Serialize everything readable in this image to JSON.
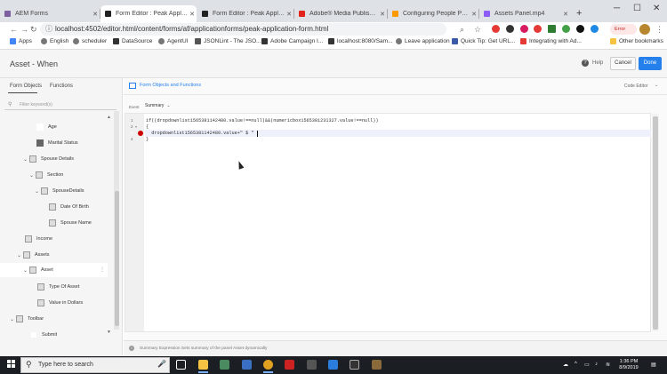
{
  "tabs": [
    {
      "title": "AEM Forms",
      "fav": "#7d5fa0"
    },
    {
      "title": "Form Editor : Peak Applicatio",
      "fav": "#222222"
    },
    {
      "title": "Form Editor : Peak Applicatio",
      "fav": "#222222"
    },
    {
      "title": "Adobe® Media Publishing",
      "fav": "#e1251b"
    },
    {
      "title": "Configuring People Panel in",
      "fav": "#ff9a00"
    },
    {
      "title": "Assets Panel.mp4",
      "fav": "#8e5cf7"
    }
  ],
  "window": {
    "minimize": "─",
    "maximize": "☐",
    "close": "✕",
    "new_tab": "+"
  },
  "url": "localhost:4502/editor.html/content/forms/af/applicationforms/peak-application-form.html",
  "bookmarks": [
    "Apps",
    "English",
    "scheduler",
    "DataSource",
    "AgentUI",
    "JSONLint - The JSO...",
    "Adobe Campaign I...",
    "localhost:8080/Sam...",
    "Leave application",
    "Quick Tip: Get URL...",
    "Integrating with Ad..."
  ],
  "other_bookmarks": "Other bookmarks",
  "profile_label": "Error",
  "header": {
    "title": "Asset - When",
    "help": "Help",
    "cancel": "Cancel",
    "done": "Done"
  },
  "left_tabs": [
    "Form Objects",
    "Functions"
  ],
  "filter_placeholder": "Filter keyword(s)",
  "tree": [
    {
      "label": "Age"
    },
    {
      "label": "Marital Status"
    },
    {
      "label": "Spouse Details"
    },
    {
      "label": "Section"
    },
    {
      "label": "SpouseDetails"
    },
    {
      "label": "Date Of Birth"
    },
    {
      "label": "Spouse Name"
    },
    {
      "label": "Income"
    },
    {
      "label": "Assets"
    },
    {
      "label": "Asset"
    },
    {
      "label": "Type Of Asset"
    },
    {
      "label": "Value in Dollars"
    },
    {
      "label": "Toolbar"
    },
    {
      "label": "Submit"
    }
  ],
  "right": {
    "title": "Form Objects and Functions",
    "code_editor": "Code Editor",
    "event_label": "Event",
    "event_value": "Summary"
  },
  "code": {
    "line_numbers": [
      "1",
      "2",
      "3",
      "4"
    ],
    "lines": [
      "if((dropdownlist1565381142480.value!==null)&&(numericbox1565381231327.value!==null))",
      "{",
      "  dropdownlist1565381142480.value+\" $ \"",
      "}"
    ]
  },
  "footer": "Summary Expression Sets summary of the panel Asset dynamically",
  "taskbar": {
    "search_placeholder": "Type here to search",
    "time": "1:36 PM",
    "date": "8/9/2019"
  }
}
